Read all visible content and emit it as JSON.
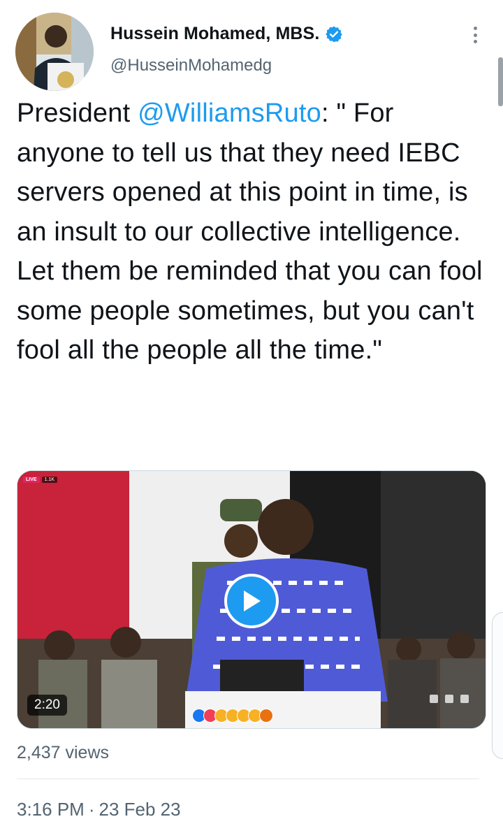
{
  "author": {
    "name": "Hussein Mohamed, MBS.",
    "handle": "@HusseinMohamedg",
    "avatar_icon": "profile-photo"
  },
  "tweet": {
    "text_before": "President ",
    "mention": "@WilliamsRuto",
    "text_after": ": \" For anyone to tell us that they need IEBC servers opened at this point in time, is an insult to our collective intelligence. Let them be reminded that you can fool some people sometimes, but you can't fool all the people all the time.\""
  },
  "media": {
    "live_label": "LIVE",
    "viewer_count": "1.1K",
    "duration": "2:20",
    "podium_text": "REPUBLIC OF",
    "play_icon": "play-icon"
  },
  "stats": {
    "views": "2,437 views"
  },
  "meta": {
    "time": "3:16 PM",
    "separator": "·",
    "date": "23 Feb 23"
  },
  "colors": {
    "link": "#1d9bf0",
    "secondary_text": "#536471",
    "verified": "#1d9bf0"
  }
}
